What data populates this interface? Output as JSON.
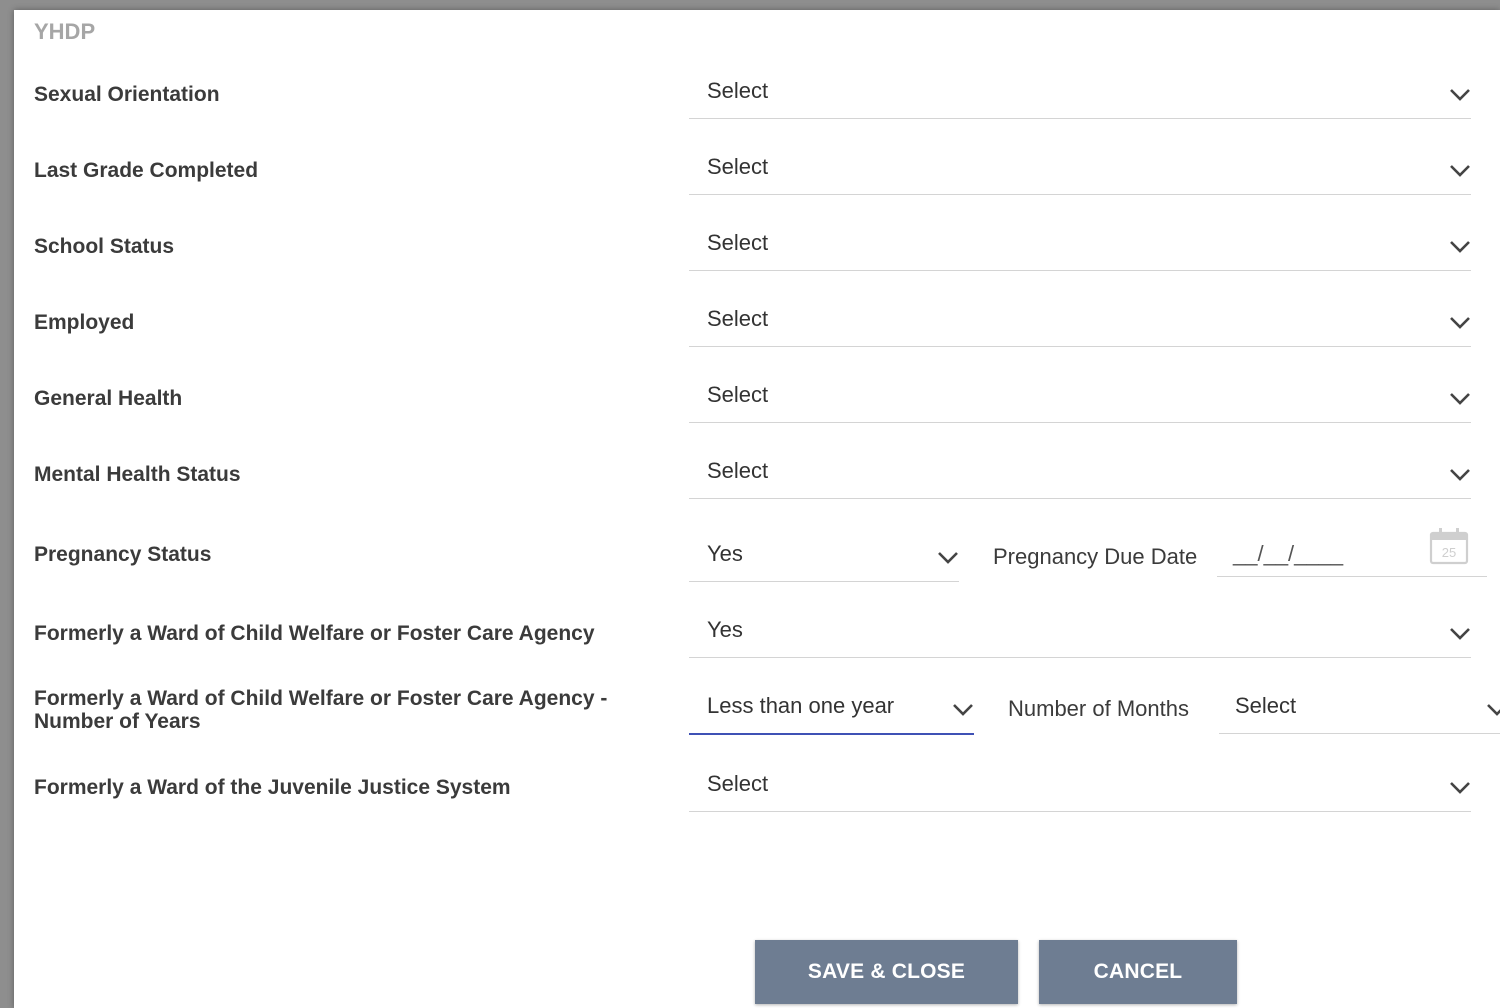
{
  "section": {
    "title": "YHDP"
  },
  "fields": [
    {
      "label": "Sexual Orientation",
      "value": "Select"
    },
    {
      "label": "Last Grade Completed",
      "value": "Select"
    },
    {
      "label": "School Status",
      "value": "Select"
    },
    {
      "label": "Employed",
      "value": "Select"
    },
    {
      "label": "General Health",
      "value": "Select"
    },
    {
      "label": "Mental Health Status",
      "value": "Select"
    },
    {
      "label": "Pregnancy Status",
      "value": "Yes"
    },
    {
      "label": "Formerly a Ward of Child Welfare or Foster Care Agency",
      "value": "Yes"
    },
    {
      "label_line1": "Formerly a Ward of Child Welfare or Foster Care Agency -",
      "label_line2": "Number of Years",
      "value": "Less than one year"
    },
    {
      "label": "Formerly a Ward of the Juvenile Justice System",
      "value": "Select"
    }
  ],
  "pregnancy_due_date": {
    "label": "Pregnancy Due Date",
    "mask": "__/__/____",
    "calendar_icon_text": "25"
  },
  "number_of_months": {
    "label": "Number of Months",
    "value": "Select"
  },
  "buttons": {
    "save_close": "SAVE & CLOSE",
    "cancel": "CANCEL"
  },
  "colors": {
    "button_bg": "#6e7d92",
    "active_underline": "#3f51b5",
    "label_text": "#3b3b3b",
    "section_title": "#a6a6a6"
  }
}
